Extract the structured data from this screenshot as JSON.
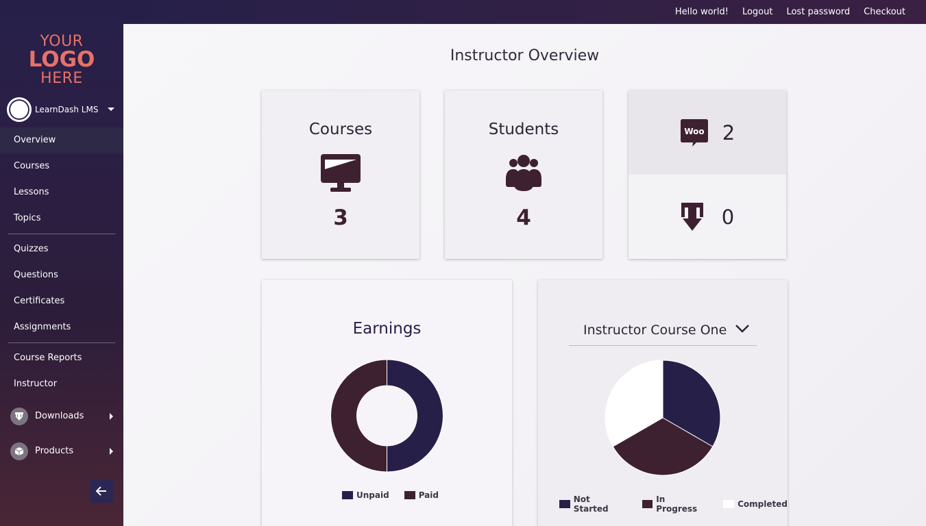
{
  "topnav": {
    "greeting": "Hello world!",
    "logout": "Logout",
    "lost_password": "Lost password",
    "checkout": "Checkout"
  },
  "logo": {
    "line1": "YOUR",
    "line2": "LOGO",
    "line3": "HERE"
  },
  "account": {
    "name": "LearnDash LMS"
  },
  "sidebar": {
    "items": [
      {
        "label": "Overview"
      },
      {
        "label": "Courses"
      },
      {
        "label": "Lessons"
      },
      {
        "label": "Topics"
      },
      {
        "label": "Quizzes"
      },
      {
        "label": "Questions"
      },
      {
        "label": "Certificates"
      },
      {
        "label": "Assignments"
      },
      {
        "label": "Course Reports"
      },
      {
        "label": "Instructor"
      }
    ],
    "submenus": [
      {
        "label": "Downloads",
        "icon": "download-icon"
      },
      {
        "label": "Products",
        "icon": "box-icon"
      }
    ]
  },
  "page": {
    "title": "Instructor Overview"
  },
  "cards": {
    "courses": {
      "title": "Courses",
      "value": "3",
      "icon": "monitor-icon"
    },
    "students": {
      "title": "Students",
      "value": "4",
      "icon": "users-icon"
    },
    "woo": {
      "label": "Woo",
      "value": "2",
      "icon": "woocommerce-icon"
    },
    "downloads": {
      "value": "0",
      "icon": "download-icon"
    }
  },
  "earnings": {
    "title": "Earnings",
    "legend": [
      "Unpaid",
      "Paid"
    ]
  },
  "progress": {
    "selected_course": "Instructor Course One",
    "legend": [
      "Not Started",
      "In Progress",
      "Completed"
    ]
  },
  "colors": {
    "navy": "#262049",
    "plum": "#3e2131",
    "white": "#ffffff",
    "logo": "#e8716a"
  },
  "chart_data": [
    {
      "type": "pie",
      "title": "Earnings",
      "donut": true,
      "categories": [
        "Unpaid",
        "Paid"
      ],
      "values": [
        50,
        50
      ],
      "colors": [
        "#262049",
        "#3e2131"
      ],
      "legend": "bottom"
    },
    {
      "type": "pie",
      "title": "Instructor Course One",
      "categories": [
        "Not Started",
        "In Progress",
        "Completed"
      ],
      "values": [
        33.3,
        33.3,
        33.3
      ],
      "colors": [
        "#262049",
        "#3e2131",
        "#ffffff"
      ],
      "legend": "bottom"
    }
  ]
}
